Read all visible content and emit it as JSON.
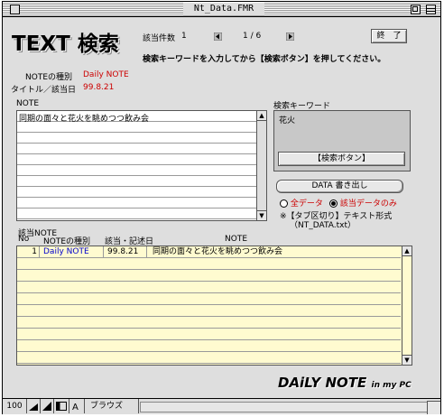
{
  "window": {
    "title": "Nt_Data.FMR"
  },
  "header": {
    "logo": "TEXT 検索",
    "count_label": "該当件数",
    "count_value": "1",
    "record_position": "1 / 6",
    "exit_label": "終　了",
    "instruction": "検索キーワードを入力してから【検索ボタン】を押してください。"
  },
  "fields": {
    "note_type_label": "NOTEの種別",
    "note_type_value": "Daily NOTE",
    "title_date_label": "タイトル／該当日",
    "title_date_value": "99.8.21",
    "note_label": "NOTE",
    "note_text": "同期の面々と花火を眺めつつ飲み会"
  },
  "search": {
    "keyword_label": "検索キーワード",
    "keyword_value": "花火",
    "search_button": "【検索ボタン】"
  },
  "export": {
    "button_label": "DATA 書き出し",
    "option_all": "全データ",
    "option_hits": "該当データのみ",
    "selected": "option_hits",
    "note_line1": "※【タブ区切り】テキスト形式",
    "note_line2": "（NT_DATA.txt）"
  },
  "results": {
    "section_label": "該当NOTE",
    "columns": [
      "No",
      "NOTEの種別",
      "該当・記述日",
      "NOTE"
    ],
    "rows": [
      {
        "no": "1",
        "type": "Daily NOTE",
        "date": "99.8.21",
        "note": "同期の面々と花火を眺めつつ飲み会"
      }
    ]
  },
  "branding": {
    "main": "DAiLY NOTE",
    "sub": "in my PC"
  },
  "statusbar": {
    "zoom": "100",
    "mode": "ブラウズ"
  },
  "colors": {
    "red": "#cc0000",
    "blue": "#0000cc",
    "table_bg": "#fffbd0"
  }
}
